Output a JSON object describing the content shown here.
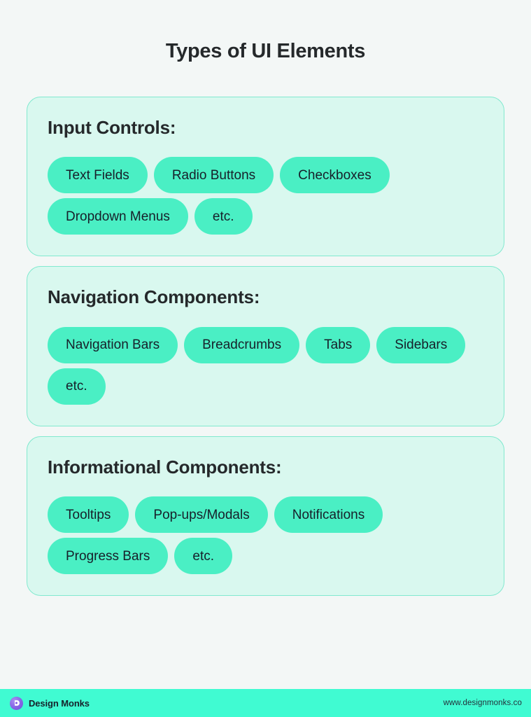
{
  "page": {
    "title": "Types of UI Elements",
    "background_color": "#f3f7f6"
  },
  "theme": {
    "card_background": "#d9f8ef",
    "card_border": "#82e9cf",
    "pill_background": "#4aefc4",
    "footer_background": "#40fbd2",
    "text_color": "#25292b",
    "logo_color": "#7b57e0"
  },
  "cards": [
    {
      "title": "Input Controls:",
      "items": [
        "Text Fields",
        "Radio Buttons",
        "Checkboxes",
        "Dropdown Menus",
        "etc."
      ]
    },
    {
      "title": "Navigation Components:",
      "items": [
        "Navigation Bars",
        "Breadcrumbs",
        "Tabs",
        "Sidebars",
        "etc."
      ]
    },
    {
      "title": "Informational Components:",
      "items": [
        "Tooltips",
        "Pop-ups/Modals",
        "Notifications",
        "Progress Bars",
        "etc."
      ]
    }
  ],
  "footer": {
    "logo_icon": "design-monks-logo-icon",
    "brand_name": "Design Monks",
    "url": "www.designmonks.co"
  }
}
